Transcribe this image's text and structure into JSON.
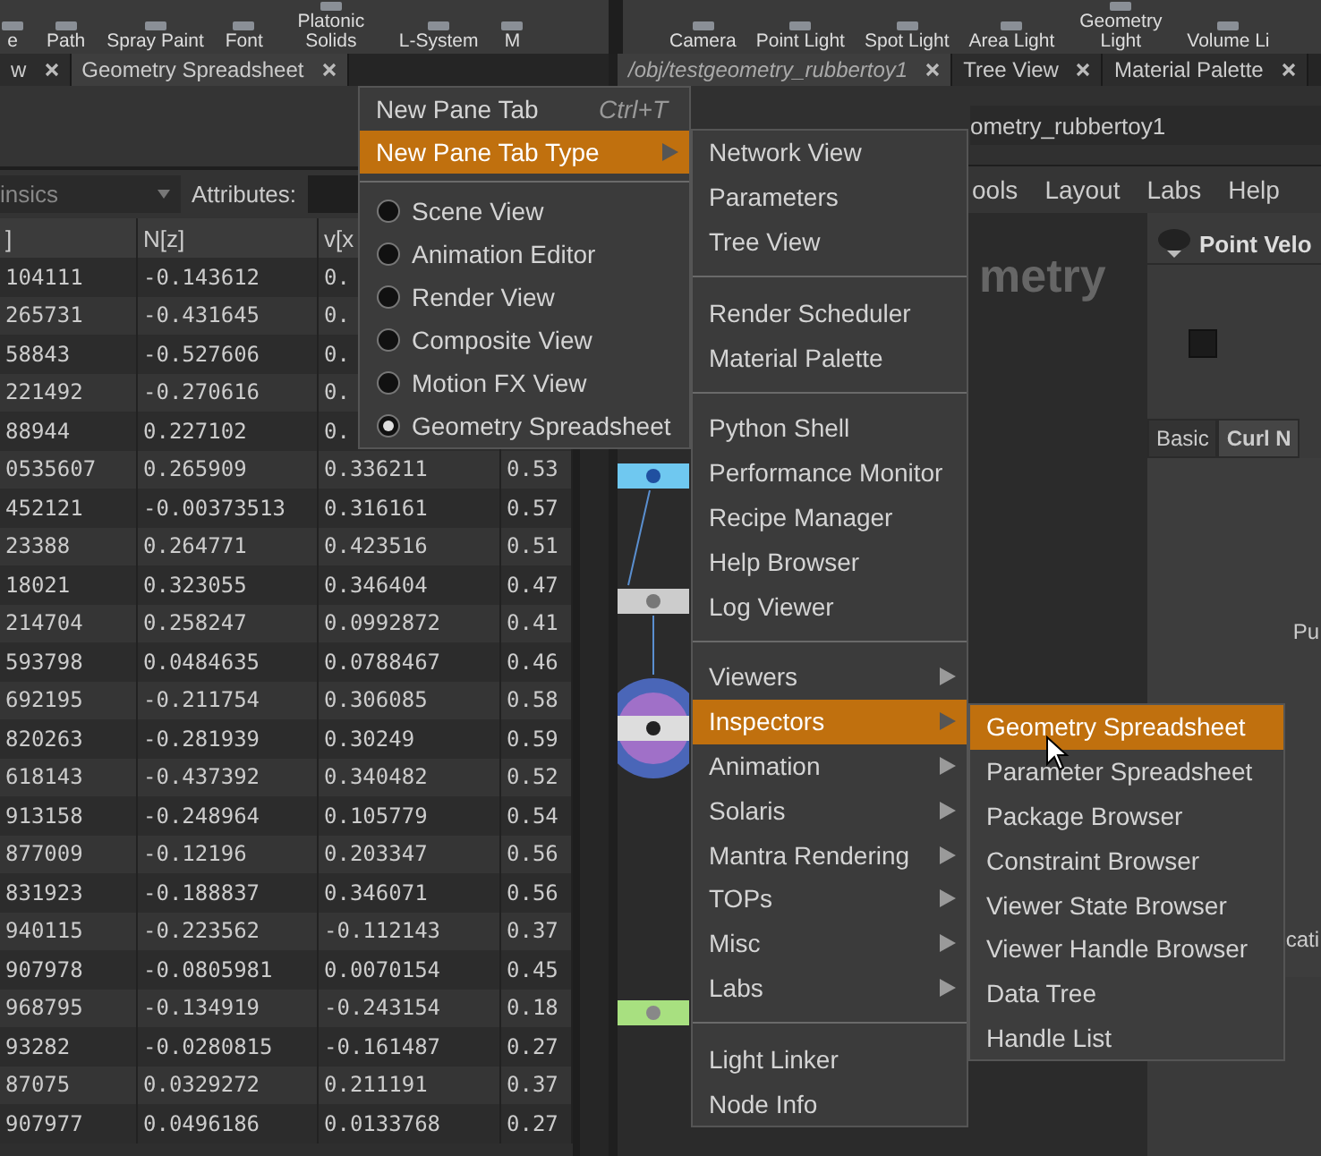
{
  "shelf_left": [
    {
      "label": "e"
    },
    {
      "label": "Path"
    },
    {
      "label": "Spray Paint"
    },
    {
      "label": "Font"
    },
    {
      "label": "Platonic Solids"
    },
    {
      "label": "L-System"
    },
    {
      "label": "M"
    }
  ],
  "shelf_right": [
    {
      "label": "Camera"
    },
    {
      "label": "Point Light"
    },
    {
      "label": "Spot Light"
    },
    {
      "label": "Area Light"
    },
    {
      "label": "Geometry Light"
    },
    {
      "label": "Volume Li"
    }
  ],
  "left_pane": {
    "tabs": [
      {
        "label": "w",
        "selected": false
      },
      {
        "label": "Geometry Spreadsheet",
        "selected": true
      }
    ],
    "filter": {
      "value": "insics"
    },
    "attributes_label": "Attributes:",
    "table": {
      "columns": [
        "]",
        "N[z]",
        "v[x"
      ],
      "rows": [
        [
          "104111",
          "-0.143612",
          "0."
        ],
        [
          "265731",
          "-0.431645",
          "0."
        ],
        [
          "58843",
          "-0.527606",
          "0."
        ],
        [
          "221492",
          "-0.270616",
          "0."
        ],
        [
          "88944",
          "0.227102",
          "0."
        ],
        [
          "0535607",
          "0.265909",
          "0.336211",
          "0.53"
        ],
        [
          "452121",
          "-0.00373513",
          "0.316161",
          "0.57"
        ],
        [
          "23388",
          "0.264771",
          "0.423516",
          "0.51"
        ],
        [
          "18021",
          "0.323055",
          "0.346404",
          "0.47"
        ],
        [
          "214704",
          "0.258247",
          "0.0992872",
          "0.41"
        ],
        [
          "593798",
          "0.0484635",
          "0.0788467",
          "0.46"
        ],
        [
          "692195",
          "-0.211754",
          "0.306085",
          "0.58"
        ],
        [
          "820263",
          "-0.281939",
          "0.30249",
          "0.59"
        ],
        [
          "618143",
          "-0.437392",
          "0.340482",
          "0.52"
        ],
        [
          "913158",
          "-0.248964",
          "0.105779",
          "0.54"
        ],
        [
          "877009",
          "-0.12196",
          "0.203347",
          "0.56"
        ],
        [
          "831923",
          "-0.188837",
          "0.346071",
          "0.56"
        ],
        [
          "940115",
          "-0.223562",
          "-0.112143",
          "0.37"
        ],
        [
          "907978",
          "-0.0805981",
          "0.0070154",
          "0.45"
        ],
        [
          "968795",
          "-0.134919",
          "-0.243154",
          "0.18"
        ],
        [
          "93282",
          "-0.0280815",
          "-0.161487",
          "0.27"
        ],
        [
          "87075",
          "0.0329272",
          "0.211191",
          "0.37"
        ],
        [
          "907977",
          "0.0496186",
          "0.0133768",
          "0.27"
        ]
      ]
    }
  },
  "right_pane": {
    "tabs": [
      {
        "label": "/obj/testgeometry_rubbertoy1",
        "selected": true
      },
      {
        "label": "Tree View",
        "selected": false
      },
      {
        "label": "Material Palette",
        "selected": false
      }
    ],
    "path": "ometry_rubbertoy1",
    "menu_bar": [
      "ools",
      "Layout",
      "Labs",
      "Help"
    ],
    "network_label": "metry",
    "parameters": {
      "node_name": "Point Velo",
      "checkbox": {
        "checked": false
      },
      "tabs": [
        {
          "label": "Basic",
          "selected": false
        },
        {
          "label": "Curl N",
          "selected": true
        }
      ],
      "text_1": "Pu",
      "text_2": "cati"
    }
  },
  "pane_menu": {
    "items": [
      {
        "kind": "action",
        "label": "New Pane Tab",
        "shortcut": "Ctrl+T",
        "selected": false
      },
      {
        "kind": "submenu",
        "label": "New Pane Tab Type",
        "selected": true
      },
      {
        "kind": "separator"
      },
      {
        "kind": "radio",
        "label": "Scene View",
        "checked": false,
        "selected": false
      },
      {
        "kind": "radio",
        "label": "Animation Editor",
        "checked": false,
        "selected": false
      },
      {
        "kind": "radio",
        "label": "Render View",
        "checked": false,
        "selected": false
      },
      {
        "kind": "radio",
        "label": "Composite View",
        "checked": false,
        "selected": false
      },
      {
        "kind": "radio",
        "label": "Motion FX View",
        "checked": false,
        "selected": false
      },
      {
        "kind": "radio",
        "label": "Geometry Spreadsheet",
        "checked": true,
        "selected": false
      }
    ]
  },
  "type_menu": {
    "items": [
      {
        "kind": "action",
        "label": "Network View",
        "selected": false
      },
      {
        "kind": "action",
        "label": "Parameters",
        "selected": false
      },
      {
        "kind": "action",
        "label": "Tree View",
        "selected": false
      },
      {
        "kind": "separator"
      },
      {
        "kind": "action",
        "label": "Render Scheduler",
        "selected": false
      },
      {
        "kind": "action",
        "label": "Material Palette",
        "selected": false
      },
      {
        "kind": "separator"
      },
      {
        "kind": "action",
        "label": "Python Shell",
        "selected": false
      },
      {
        "kind": "action",
        "label": "Performance Monitor",
        "selected": false
      },
      {
        "kind": "action",
        "label": "Recipe Manager",
        "selected": false
      },
      {
        "kind": "action",
        "label": "Help Browser",
        "selected": false
      },
      {
        "kind": "action",
        "label": "Log Viewer",
        "selected": false
      },
      {
        "kind": "separator"
      },
      {
        "kind": "submenu",
        "label": "Viewers",
        "selected": false
      },
      {
        "kind": "submenu",
        "label": "Inspectors",
        "selected": true
      },
      {
        "kind": "submenu",
        "label": "Animation",
        "selected": false
      },
      {
        "kind": "submenu",
        "label": "Solaris",
        "selected": false
      },
      {
        "kind": "submenu",
        "label": "Mantra Rendering",
        "selected": false
      },
      {
        "kind": "submenu",
        "label": "TOPs",
        "selected": false
      },
      {
        "kind": "submenu",
        "label": "Misc",
        "selected": false
      },
      {
        "kind": "submenu",
        "label": "Labs",
        "selected": false
      },
      {
        "kind": "separator"
      },
      {
        "kind": "action",
        "label": "Light Linker",
        "selected": false
      },
      {
        "kind": "action",
        "label": "Node Info",
        "selected": false
      }
    ]
  },
  "inspectors_menu": {
    "items": [
      {
        "kind": "action",
        "label": "Geometry Spreadsheet",
        "selected": true
      },
      {
        "kind": "action",
        "label": "Parameter Spreadsheet",
        "selected": false
      },
      {
        "kind": "action",
        "label": "Package Browser",
        "selected": false
      },
      {
        "kind": "action",
        "label": "Constraint Browser",
        "selected": false
      },
      {
        "kind": "action",
        "label": "Viewer State Browser",
        "selected": false
      },
      {
        "kind": "action",
        "label": "Viewer Handle Browser",
        "selected": false
      },
      {
        "kind": "action",
        "label": "Data Tree",
        "selected": false
      },
      {
        "kind": "action",
        "label": "Handle List",
        "selected": false
      }
    ]
  }
}
